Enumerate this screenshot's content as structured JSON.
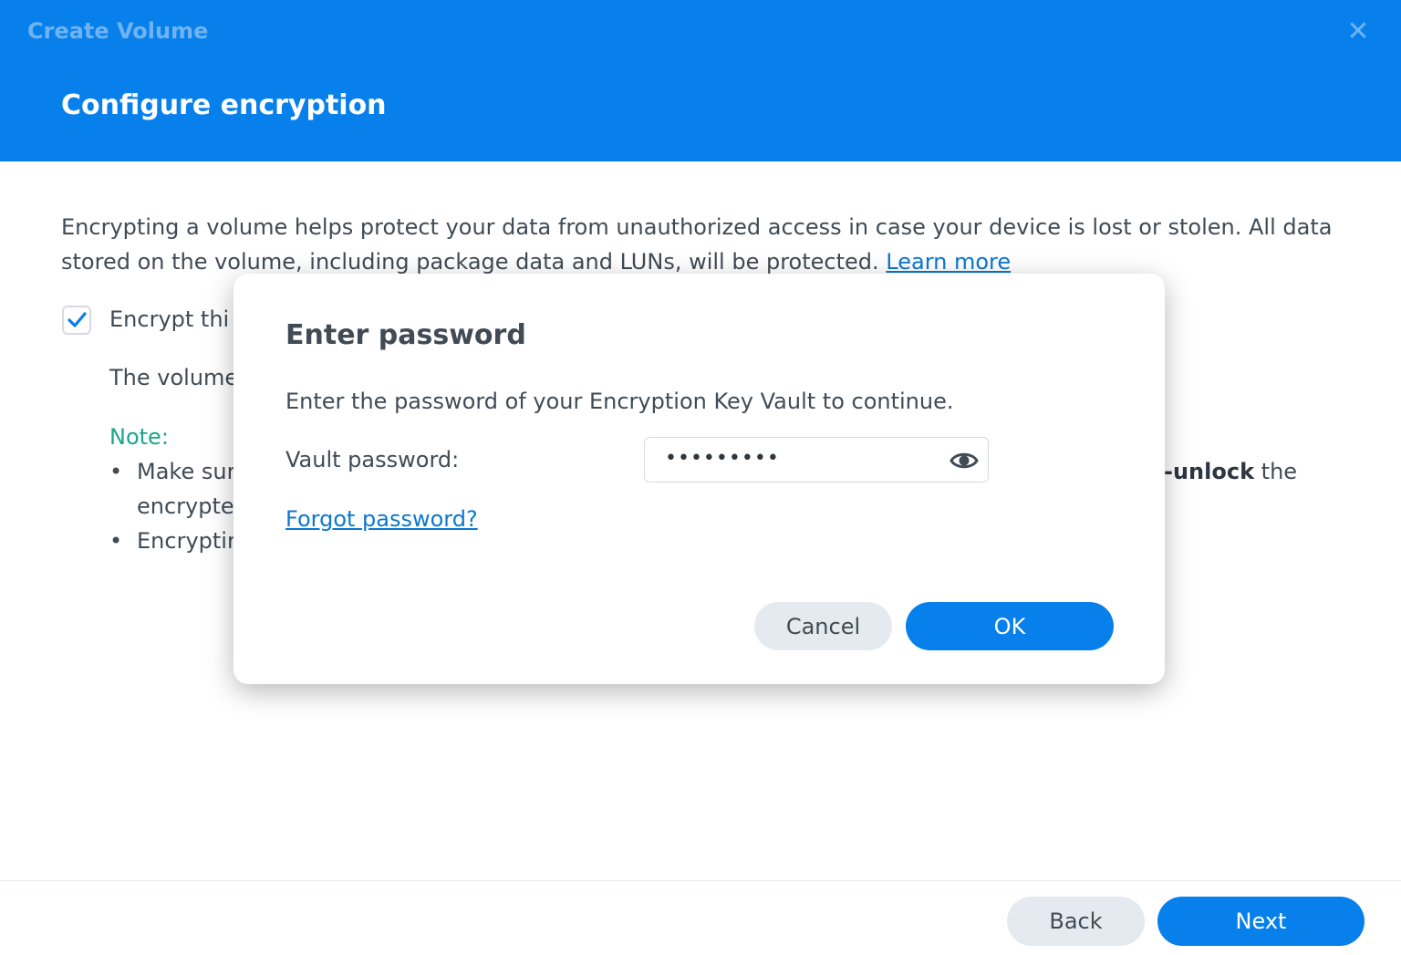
{
  "window": {
    "title": "Create Volume",
    "close_icon": "close-icon",
    "heading": "Configure encryption"
  },
  "body": {
    "description": "Encrypting a volume helps protect your data from unauthorized access in case your device is lost or stolen. All data stored on the volume, including package data and LUNs, will be protected. ",
    "learn_more": "Learn more",
    "encrypt_checkbox": {
      "label": "Encrypt thi",
      "checked": true
    },
    "volume_text": "The volume",
    "note_label": "Note:",
    "bullets": [
      {
        "line1": "Make sur",
        "line2": "encrypte"
      },
      {
        "line1": "Encryptir",
        "line2": ""
      }
    ],
    "right_fragment": {
      "bold": "-unlock",
      "rest": " the"
    }
  },
  "footer": {
    "back_label": "Back",
    "next_label": "Next"
  },
  "dialog": {
    "title": "Enter password",
    "description": "Enter the password of your Encryption Key Vault to continue.",
    "field_label": "Vault password:",
    "password_masked": "•••••••••",
    "toggle_icon": "eye-icon",
    "forgot_label": "Forgot password?",
    "cancel_label": "Cancel",
    "ok_label": "OK"
  },
  "colors": {
    "accent": "#0880eb",
    "link": "#0b78d1",
    "note": "#19a58e"
  }
}
